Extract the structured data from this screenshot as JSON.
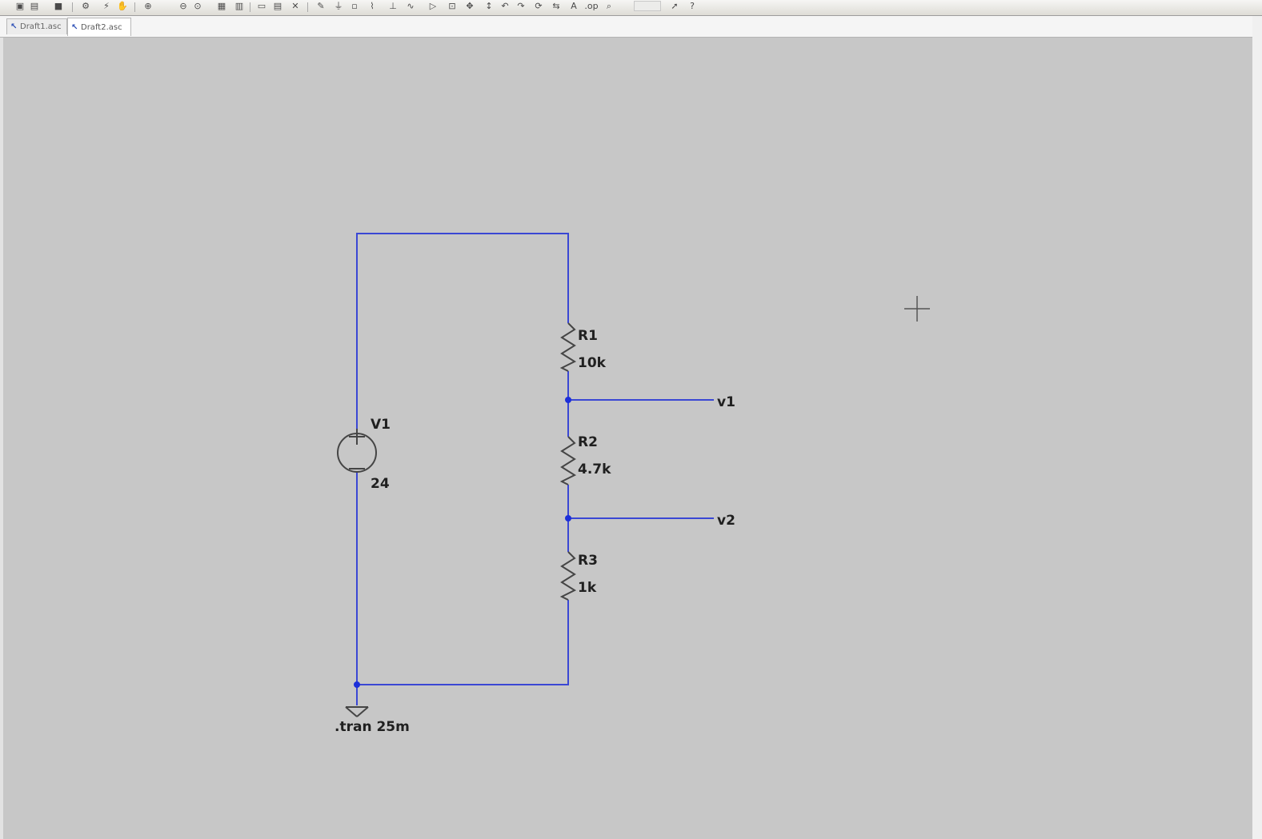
{
  "tabs": [
    {
      "label": "Draft1.asc",
      "active": false
    },
    {
      "label": "Draft2.asc",
      "active": true
    }
  ],
  "toolbar": {
    "icons": [
      "new-schematic-icon",
      "open-icon",
      "save-icon",
      "control-panel-icon",
      "run-icon",
      "halt-icon",
      "zoom-in-icon",
      "zoom-out-icon",
      "zoom-fit-icon",
      "autoscale-icon",
      "tile-icon",
      "cascade-icon",
      "close-icon",
      "wire-icon",
      "ground-icon",
      "label-net-icon",
      "resistor-icon",
      "capacitor-icon",
      "inductor-icon",
      "diode-icon",
      "component-icon",
      "move-icon",
      "drag-icon",
      "undo-icon",
      "redo-icon",
      "rotate-icon",
      "mirror-icon",
      "text-icon",
      "spice-directive-icon"
    ]
  },
  "schematic": {
    "accent_wire_color": "#3a47d4",
    "components": [
      {
        "ref": "V1",
        "value": "24",
        "type": "voltage-source"
      },
      {
        "ref": "R1",
        "value": "10k",
        "type": "resistor"
      },
      {
        "ref": "R2",
        "value": "4.7k",
        "type": "resistor"
      },
      {
        "ref": "R3",
        "value": "1k",
        "type": "resistor"
      }
    ],
    "net_labels": [
      "v1",
      "v2"
    ],
    "directive": ".tran 25m"
  }
}
